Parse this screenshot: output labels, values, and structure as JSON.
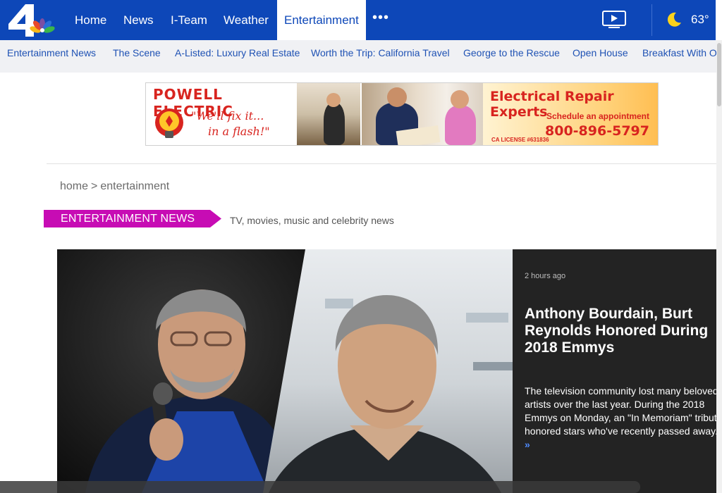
{
  "nav": {
    "logo_text": "4",
    "items": [
      {
        "label": "Home"
      },
      {
        "label": "News"
      },
      {
        "label": "I-Team"
      },
      {
        "label": "Weather"
      },
      {
        "label": "Entertainment",
        "active": true
      }
    ],
    "more_label": "•••",
    "weather": {
      "temp": "63°",
      "icon": "moon-icon"
    },
    "tv_icon": "tv-play-icon",
    "brand_color": "#0d47b8"
  },
  "subnav": {
    "items": [
      {
        "label": "Entertainment News"
      },
      {
        "label": "The Scene"
      },
      {
        "label": "A-Listed: Luxury Real Estate"
      },
      {
        "label": "Worth the Trip: California Travel"
      },
      {
        "label": "George to the Rescue"
      },
      {
        "label": "Open House"
      },
      {
        "label": "Breakfast With Ops"
      }
    ]
  },
  "ad": {
    "brand": "POWELL ELECTRIC",
    "tagline_1": "\"We'll fix it...",
    "tagline_2": "in a flash!\"",
    "headline": "Electrical Repair Experts",
    "schedule": "Schedule an appointment",
    "license": "CA LICENSE #631836",
    "phone": "800-896-5797"
  },
  "breadcrumb": {
    "home": "home",
    "separator": ">",
    "current": "entertainment"
  },
  "section": {
    "label": "ENTERTAINMENT NEWS",
    "description": "TV, movies, music and celebrity news",
    "accent": "#c70cb4"
  },
  "hero": {
    "time": "2 hours ago",
    "title": "Anthony Bourdain, Burt Reynolds Honored During 2018 Emmys",
    "description": "The television community lost many beloved artists over the last year. During the 2018 Emmys on Monday, an \"In Memoriam\" tribute honored stars who've recently passed away.",
    "more": "»"
  }
}
